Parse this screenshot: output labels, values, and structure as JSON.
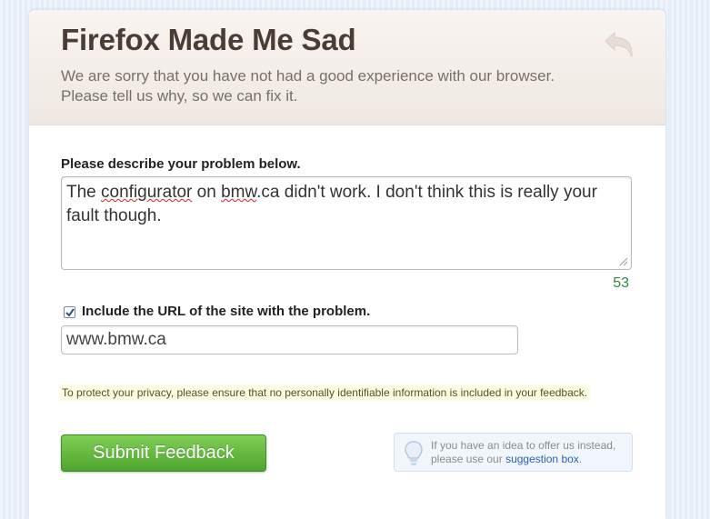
{
  "header": {
    "title": "Firefox Made Me Sad",
    "subtitle_line1": "We are sorry that you have not had a good experience with our browser.",
    "subtitle_line2": "Please tell us why, so we can fix it.",
    "back_icon": "undo-arrow-icon"
  },
  "form": {
    "problem_label": "Please describe your problem below.",
    "problem_text": {
      "part1": "The ",
      "misspelled1": "configurator",
      "part2": " on ",
      "misspelled2": "bmw",
      "part3": ".ca didn't work. I don't think this is really your fault though."
    },
    "char_count": "53",
    "include_url_checked": true,
    "include_url_label": "Include the URL of the site with the problem.",
    "url_value": "www.bmw.ca",
    "privacy_note": "To protect your privacy, please ensure that no personally identifiable information is included in your feedback.",
    "submit_label": "Submit Feedback"
  },
  "suggestion": {
    "icon": "lightbulb-icon",
    "line1": "If you have an idea to offer us instead,",
    "line2_prefix": "please use our ",
    "link_text": "suggestion box",
    "line2_suffix": "."
  },
  "colors": {
    "title": "#4a3d36",
    "counter": "#2e8a3a",
    "submit_green": "#5bb336",
    "link": "#2a62b0"
  }
}
